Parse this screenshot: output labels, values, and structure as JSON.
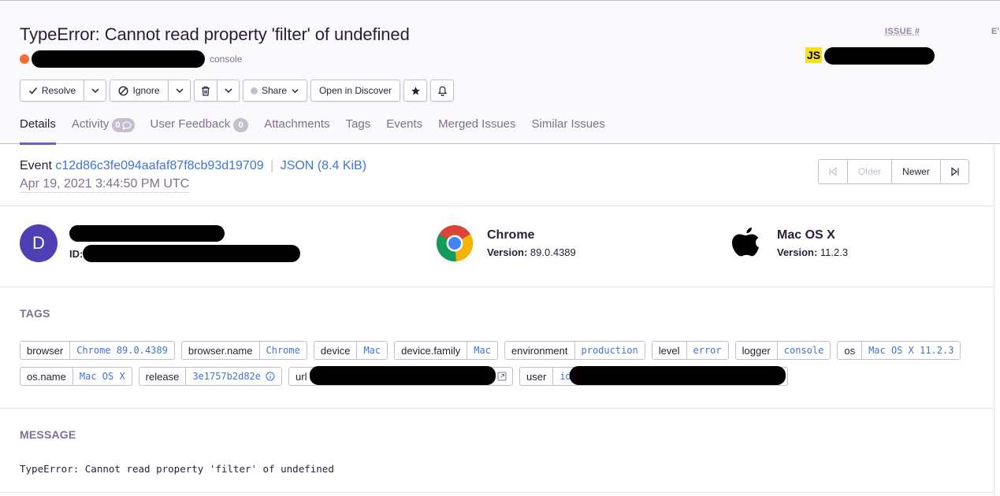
{
  "issue": {
    "title": "TypeError: Cannot read property 'filter' of undefined",
    "logger": "console",
    "issue_label": "ISSUE #",
    "ev_label": "E'",
    "platform_badge": "JS",
    "level_color": "#f86a33"
  },
  "actions": {
    "resolve": "Resolve",
    "ignore": "Ignore",
    "share": "Share",
    "discover": "Open in Discover"
  },
  "tabs": [
    {
      "label": "Details",
      "active": true
    },
    {
      "label": "Activity",
      "count": "0"
    },
    {
      "label": "User Feedback",
      "count": "0"
    },
    {
      "label": "Attachments"
    },
    {
      "label": "Tags"
    },
    {
      "label": "Events"
    },
    {
      "label": "Merged Issues"
    },
    {
      "label": "Similar Issues"
    }
  ],
  "event": {
    "label": "Event",
    "id": "c12d86c3fe094aafaf87f8cb93d19709",
    "json": "JSON (8.4 KiB)",
    "date": "Apr 19, 2021 3:44:50 PM UTC"
  },
  "pager": {
    "older": "Older",
    "newer": "Newer"
  },
  "context": {
    "user_initial": "D",
    "user_id_label": "ID:",
    "browser_name": "Chrome",
    "browser_version_label": "Version:",
    "browser_version": "89.0.4389",
    "os_name": "Mac OS X",
    "os_version_label": "Version:",
    "os_version": "11.2.3"
  },
  "tags_title": "TAGS",
  "tags": [
    {
      "key": "browser",
      "value": "Chrome 89.0.4389"
    },
    {
      "key": "browser.name",
      "value": "Chrome"
    },
    {
      "key": "device",
      "value": "Mac"
    },
    {
      "key": "device.family",
      "value": "Mac"
    },
    {
      "key": "environment",
      "value": "production"
    },
    {
      "key": "level",
      "value": "error"
    },
    {
      "key": "logger",
      "value": "console"
    },
    {
      "key": "os",
      "value": "Mac OS X 11.2.3"
    },
    {
      "key": "os.name",
      "value": "Mac OS X"
    },
    {
      "key": "release",
      "value": "3e1757b2d82e"
    },
    {
      "key": "url",
      "value": ""
    },
    {
      "key": "user",
      "value": "id"
    }
  ],
  "message_title": "MESSAGE",
  "message": "TypeError: Cannot read property 'filter' of undefined"
}
